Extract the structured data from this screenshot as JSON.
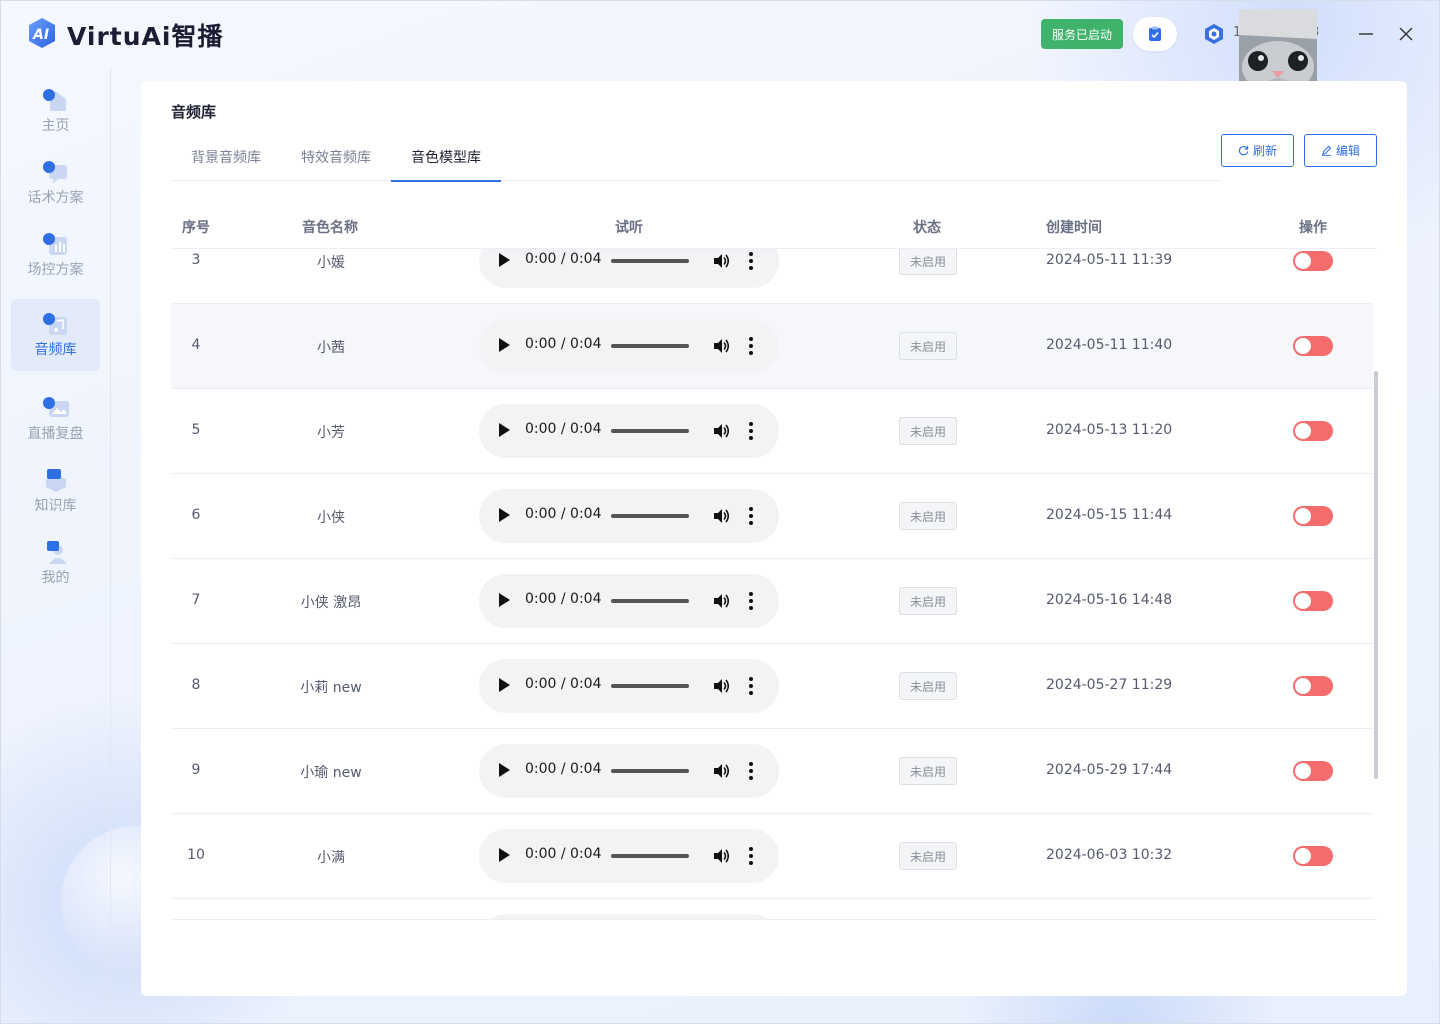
{
  "app": {
    "title": "VirtuAi智播"
  },
  "header": {
    "service_status": "服务已启动",
    "user_fragment_left": "1",
    "user_fragment_right": "3"
  },
  "sidebar": {
    "items": [
      {
        "label": "主页",
        "icon": "home-icon",
        "active": false
      },
      {
        "label": "话术方案",
        "icon": "chat-icon",
        "active": false
      },
      {
        "label": "场控方案",
        "icon": "chart-icon",
        "active": false
      },
      {
        "label": "音频库",
        "icon": "music-icon",
        "active": true
      },
      {
        "label": "直播复盘",
        "icon": "image-icon",
        "active": false
      },
      {
        "label": "知识库",
        "icon": "knowledge-icon",
        "active": false
      },
      {
        "label": "我的",
        "icon": "user-icon",
        "active": false
      }
    ]
  },
  "main": {
    "page_title": "音频库",
    "tabs": [
      {
        "label": "背景音频库",
        "active": false
      },
      {
        "label": "特效音频库",
        "active": false
      },
      {
        "label": "音色模型库",
        "active": true
      }
    ],
    "refresh_label": "刷新",
    "edit_label": "编辑",
    "columns": [
      "序号",
      "音色名称",
      "试听",
      "状态",
      "创建时间",
      "操作"
    ],
    "rows": [
      {
        "index": "3",
        "name": "小媛",
        "audio_time": "0:00 / 0:04",
        "status": "未启用",
        "created": "2024-05-11 11:39",
        "enabled": false
      },
      {
        "index": "4",
        "name": "小茜",
        "audio_time": "0:00 / 0:04",
        "status": "未启用",
        "created": "2024-05-11 11:40",
        "enabled": false
      },
      {
        "index": "5",
        "name": "小芳",
        "audio_time": "0:00 / 0:04",
        "status": "未启用",
        "created": "2024-05-13 11:20",
        "enabled": false
      },
      {
        "index": "6",
        "name": "小侠",
        "audio_time": "0:00 / 0:04",
        "status": "未启用",
        "created": "2024-05-15 11:44",
        "enabled": false
      },
      {
        "index": "7",
        "name": "小侠 激昂",
        "audio_time": "0:00 / 0:04",
        "status": "未启用",
        "created": "2024-05-16 14:48",
        "enabled": false
      },
      {
        "index": "8",
        "name": "小莉 new",
        "audio_time": "0:00 / 0:04",
        "status": "未启用",
        "created": "2024-05-27 11:29",
        "enabled": false
      },
      {
        "index": "9",
        "name": "小瑜 new",
        "audio_time": "0:00 / 0:04",
        "status": "未启用",
        "created": "2024-05-29 17:44",
        "enabled": false
      },
      {
        "index": "10",
        "name": "小满",
        "audio_time": "0:00 / 0:04",
        "status": "未启用",
        "created": "2024-06-03 10:32",
        "enabled": false
      }
    ]
  },
  "colors": {
    "accent": "#2f6fe4",
    "service_green": "#3fb36b",
    "toggle_off": "#f56c6c"
  }
}
